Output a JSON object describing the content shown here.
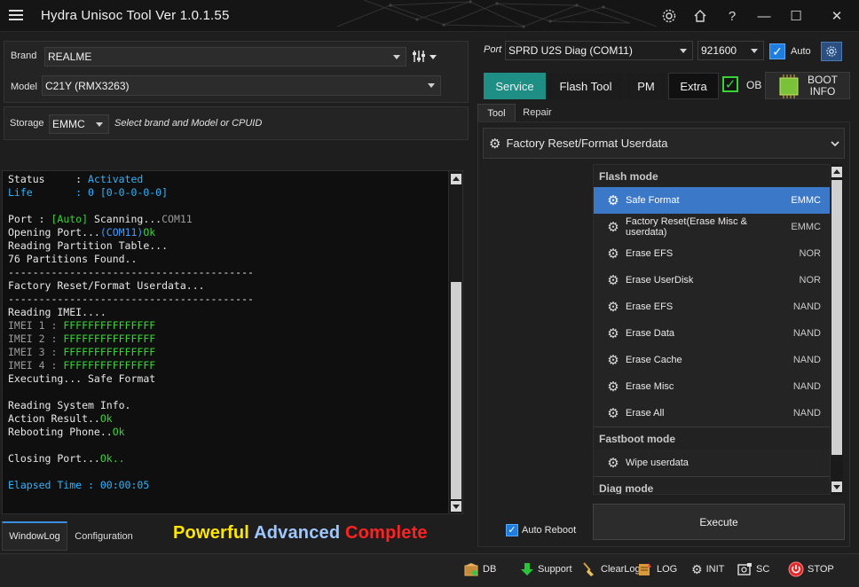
{
  "window": {
    "title": "Hydra Unisoc Tool  Ver 1.0.1.55",
    "controls": {
      "minimize": "—",
      "maximize": "☐",
      "close": "✕"
    }
  },
  "left": {
    "brand_label": "Brand",
    "brand_value": "REALME",
    "model_label": "Model",
    "model_value": "C21Y (RMX3263)",
    "storage_label": "Storage",
    "storage_value": "EMMC",
    "storage_hint": "Select brand and Model or CPUID",
    "log": [
      [
        {
          "t": "Status     : ",
          "c": "c-white"
        },
        {
          "t": "Activated",
          "c": "c-cyan"
        }
      ],
      [
        {
          "t": "Life       : 0 [0-0-0-0-0]",
          "c": "c-cyan"
        }
      ],
      [],
      [
        {
          "t": "Port : ",
          "c": "c-white"
        },
        {
          "t": "[Auto]",
          "c": "c-green"
        },
        {
          "t": " Scanning...",
          "c": "c-white"
        },
        {
          "t": "COM11",
          "c": "c-grey"
        }
      ],
      [
        {
          "t": "Opening Port...",
          "c": "c-white"
        },
        {
          "t": "(COM11)",
          "c": "c-blue"
        },
        {
          "t": "Ok",
          "c": "c-green"
        }
      ],
      [
        {
          "t": "Reading Partition Table...",
          "c": "c-white"
        }
      ],
      [
        {
          "t": "76 Partitions Found..",
          "c": "c-white"
        }
      ],
      [
        {
          "t": "----------------------------------------",
          "c": "c-white"
        }
      ],
      [
        {
          "t": "Factory Reset/Format Userdata...",
          "c": "c-white"
        }
      ],
      [
        {
          "t": "----------------------------------------",
          "c": "c-white"
        }
      ],
      [
        {
          "t": "Reading IMEI....",
          "c": "c-white"
        }
      ],
      [
        {
          "t": "IMEI 1 : ",
          "c": "c-grey"
        },
        {
          "t": "FFFFFFFFFFFFFFF",
          "c": "c-green"
        }
      ],
      [
        {
          "t": "IMEI 2 : ",
          "c": "c-grey"
        },
        {
          "t": "FFFFFFFFFFFFFFF",
          "c": "c-green"
        }
      ],
      [
        {
          "t": "IMEI 3 : ",
          "c": "c-grey"
        },
        {
          "t": "FFFFFFFFFFFFFFF",
          "c": "c-green"
        }
      ],
      [
        {
          "t": "IMEI 4 : ",
          "c": "c-grey"
        },
        {
          "t": "FFFFFFFFFFFFFFF",
          "c": "c-green"
        }
      ],
      [
        {
          "t": "Executing... Safe Format",
          "c": "c-white"
        }
      ],
      [],
      [
        {
          "t": "Reading System Info.",
          "c": "c-white"
        }
      ],
      [
        {
          "t": "Action Result..",
          "c": "c-white"
        },
        {
          "t": "Ok",
          "c": "c-green"
        }
      ],
      [
        {
          "t": "Rebooting Phone..",
          "c": "c-white"
        },
        {
          "t": "Ok",
          "c": "c-green"
        }
      ],
      [],
      [
        {
          "t": "Closing Port...",
          "c": "c-white"
        },
        {
          "t": "Ok..",
          "c": "c-green"
        }
      ],
      [],
      [
        {
          "t": "Elapsed Time : 00:00:05",
          "c": "c-cyan"
        }
      ]
    ],
    "tabs": {
      "windowlog": "WindowLog",
      "configuration": "Configuration"
    },
    "slogan": {
      "w1": "Powerful",
      "w2": "Advanced",
      "w3": "Complete"
    }
  },
  "right": {
    "port_label": "Port",
    "port_value": "SPRD U2S Diag (COM11)",
    "baud_value": "921600",
    "auto_label": "Auto",
    "tabs": {
      "service": "Service",
      "flash": "Flash Tool",
      "pm": "PM",
      "extra": "Extra"
    },
    "ob_label": "OB",
    "boot_info_1": "BOOT",
    "boot_info_2": "INFO",
    "subtabs": {
      "tool": "Tool",
      "repair": "Repair"
    },
    "operation": "Factory Reset/Format Userdata",
    "groups": {
      "flash_mode": "Flash mode",
      "fastboot_mode": "Fastboot mode",
      "diag_mode": "Diag mode"
    },
    "flash_items": [
      {
        "label": "Safe Format",
        "tag": "EMMC"
      },
      {
        "label": "Factory Reset(Erase Misc & userdata)",
        "tag": "EMMC"
      },
      {
        "label": "Erase EFS",
        "tag": "NOR"
      },
      {
        "label": "Erase UserDisk",
        "tag": "NOR"
      },
      {
        "label": "Erase EFS",
        "tag": "NAND"
      },
      {
        "label": "Erase Data",
        "tag": "NAND"
      },
      {
        "label": "Erase Cache",
        "tag": "NAND"
      },
      {
        "label": "Erase Misc",
        "tag": "NAND"
      },
      {
        "label": "Erase All",
        "tag": "NAND"
      }
    ],
    "fastboot_items": [
      {
        "label": "Wipe userdata",
        "tag": ""
      }
    ],
    "auto_reboot_label": "Auto Reboot",
    "execute_label": "Execute"
  },
  "statusbar": {
    "db": "DB",
    "support": "Support",
    "clearlog": "ClearLog",
    "log": "LOG",
    "init": "INIT",
    "sc": "SC",
    "stop": "STOP"
  },
  "colors": {
    "accent_blue": "#3c78c8",
    "service_tab": "#1f8f86",
    "log_green": "#35d535",
    "log_cyan": "#2fb4ff",
    "slogan_yellow": "#ffe600",
    "slogan_blue": "#9ec7ff",
    "slogan_red": "#ff2222"
  }
}
